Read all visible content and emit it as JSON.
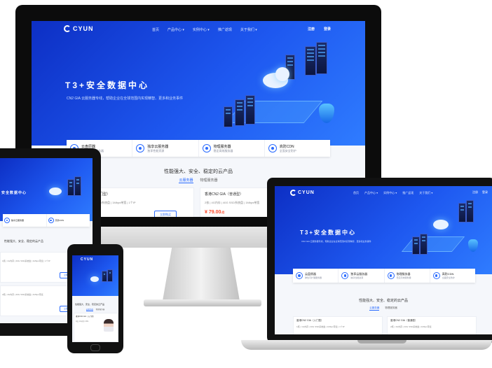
{
  "site": {
    "logo": "CYUN",
    "nav": [
      "首页",
      "产品中心 ▾",
      "实例中心 ▾",
      "推广返现",
      "关于我们 ▾"
    ],
    "login": "注册",
    "register": "登录",
    "hero_title": "T3+安全数据中心",
    "hero_subtitle": "CN2 GIA 云服务器专线，帮助企业在全球范围内实现精智、更多和业务事件",
    "features": [
      {
        "title": "云盘原器",
        "desc": "弹性可扩展服务器",
        "icon": "cloud-server-icon"
      },
      {
        "title": "独享云服务器",
        "desc": "独享性能资源",
        "icon": "monitor-icon"
      },
      {
        "title": "物理服务器",
        "desc": "稳定高效服务器",
        "icon": "globe-icon"
      },
      {
        "title": "高防CDN",
        "desc": "全面安全防护",
        "icon": "cdn-icon"
      }
    ],
    "section_title": "性能强大、安全、稳定的云产品",
    "tabs": [
      "云服务器",
      "物理服务器"
    ],
    "products": [
      {
        "name": "香港CN2 GIA（入门型）",
        "spec": "1核 | 1G内存 | 40G SSD系统盘 | 1Mbps带宽 | 1个IP",
        "price": "¥ 79.00",
        "unit": "/月",
        "button": "立即购买"
      },
      {
        "name": "香港CN2 GIA（普通型）",
        "spec": "2核 | 4G内存 | 40G SSD系统盘 | 1Mbps带宽",
        "price": "¥ 79.00",
        "unit": "/月",
        "button": "立即购买"
      }
    ],
    "mobile_product": {
      "name": "香港CN2 GIA（入门型）",
      "spec": "1核 1G内存 40G"
    }
  },
  "colors": {
    "brand": "#1e58f0",
    "price": "#ff4d2d",
    "device_frame": "#111111"
  }
}
